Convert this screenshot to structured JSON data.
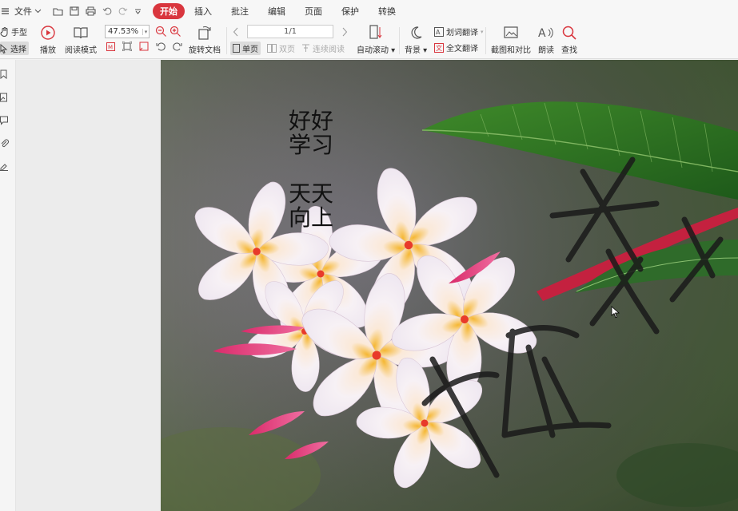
{
  "menu": {
    "file_label": "文件",
    "tabs": [
      "开始",
      "插入",
      "批注",
      "编辑",
      "页面",
      "保护",
      "转换"
    ]
  },
  "ribbon": {
    "hand_tool": "手型",
    "select_tool": "选择",
    "play": "播放",
    "read_mode": "阅读模式",
    "zoom_value": "47.53%",
    "rotate_doc": "旋转文档",
    "page_value": "1/1",
    "single_page": "单页",
    "double_page": "双页",
    "continuous_read": "连续阅读",
    "auto_scroll": "自动滚动",
    "background": "背景",
    "word_translate": "划词翻译",
    "full_translate": "全文翻译",
    "screenshot_compare": "截图和对比",
    "read_aloud": "朗读",
    "find": "查找"
  },
  "document": {
    "text_lines": [
      "好好",
      "学习",
      "天天",
      "向上"
    ],
    "handwriting": "杀毒",
    "colors": {
      "accent": "#d9363e"
    }
  }
}
